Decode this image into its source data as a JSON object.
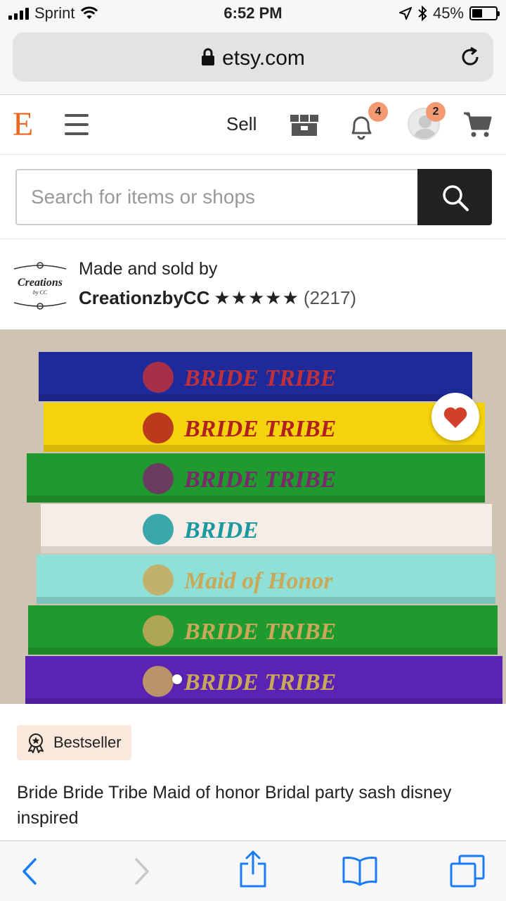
{
  "status_bar": {
    "carrier": "Sprint",
    "time": "6:52 PM",
    "battery_percent": "45%",
    "battery_level": 0.45
  },
  "browser": {
    "url": "etsy.com"
  },
  "header": {
    "logo": "E",
    "sell_label": "Sell",
    "notifications_count": "4",
    "profile_count": "2",
    "brand_color": "#f1641e"
  },
  "search": {
    "placeholder": "Search for items or shops"
  },
  "shop": {
    "made_by_label": "Made and sold by",
    "name": "CreationzbyCC",
    "stars": "★★★★★",
    "review_count": "(2217)",
    "logo_text": "Creations",
    "logo_subtext": "by CC"
  },
  "product": {
    "image_texts": [
      "BRIDE TRIBE",
      "BRIDE TRIBE",
      "BRIDE TRIBE",
      "BRIDE",
      "Maid of Honor",
      "BRIDE TRIBE",
      "BRIDE TRIBE"
    ],
    "sash_colors": [
      "#1f2a9a",
      "#f4d20c",
      "#1f9a2e",
      "#f6eee6",
      "#8fe0d6",
      "#1f9a2e",
      "#5b23b4"
    ],
    "badge_label": "Bestseller",
    "title": "Bride Bride Tribe Maid of honor Bridal party sash disney inspired",
    "favorited": true
  },
  "toolbar": {
    "back": "back-icon",
    "forward": "forward-icon",
    "share": "share-icon",
    "bookmarks": "book-icon",
    "tabs": "tabs-icon"
  }
}
